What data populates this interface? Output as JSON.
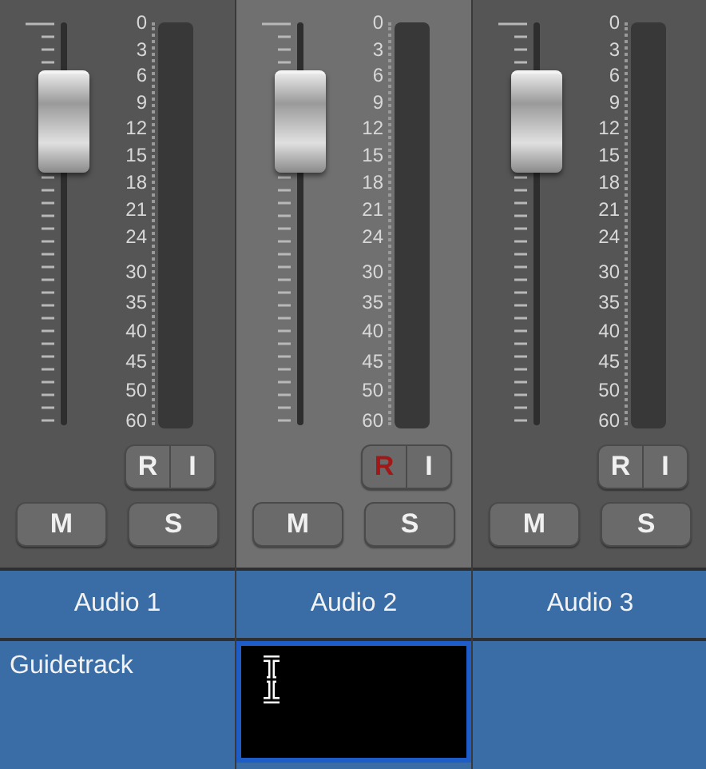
{
  "strips": [
    {
      "name": "Audio 1",
      "selected": false,
      "record_armed": false,
      "fader": {
        "level": 0.84
      },
      "scale": [
        "0",
        "3",
        "6",
        "9",
        "12",
        "15",
        "18",
        "21",
        "24",
        "30",
        "35",
        "40",
        "45",
        "50",
        "60"
      ],
      "buttons": {
        "record": "R",
        "input": "I",
        "mute": "M",
        "solo": "S"
      },
      "note": {
        "text": "Guidetrack",
        "editing": false
      }
    },
    {
      "name": "Audio 2",
      "selected": true,
      "record_armed": true,
      "fader": {
        "level": 0.84
      },
      "scale": [
        "0",
        "3",
        "6",
        "9",
        "12",
        "15",
        "18",
        "21",
        "24",
        "30",
        "35",
        "40",
        "45",
        "50",
        "60"
      ],
      "buttons": {
        "record": "R",
        "input": "I",
        "mute": "M",
        "solo": "S"
      },
      "note": {
        "editing": true
      }
    },
    {
      "name": "Audio 3",
      "selected": false,
      "record_armed": false,
      "fader": {
        "level": 0.84
      },
      "scale": [
        "0",
        "3",
        "6",
        "9",
        "12",
        "15",
        "18",
        "21",
        "24",
        "30",
        "35",
        "40",
        "45",
        "50",
        "60"
      ],
      "buttons": {
        "record": "R",
        "input": "I",
        "mute": "M",
        "solo": "S"
      }
    }
  ]
}
